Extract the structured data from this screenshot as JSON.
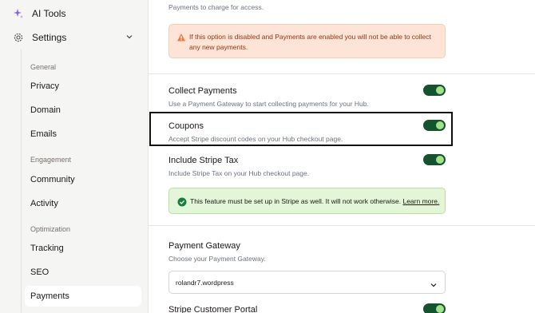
{
  "sidebar": {
    "ai_tools": "AI Tools",
    "settings": "Settings",
    "groups": {
      "general": "General",
      "engagement": "Engagement",
      "optimization": "Optimization"
    },
    "items": {
      "privacy": "Privacy",
      "domain": "Domain",
      "emails": "Emails",
      "community": "Community",
      "activity": "Activity",
      "tracking": "Tracking",
      "seo": "SEO",
      "payments": "Payments"
    }
  },
  "main": {
    "top_desc": "Payments to charge for access.",
    "warning": "If this option is disabled and Payments are enabled you will not be able to collect any new payments.",
    "collect_payments": {
      "title": "Collect Payments",
      "desc": "Use a Payment Gateway to start collecting payments for your Hub.",
      "enabled": true
    },
    "coupons": {
      "title": "Coupons",
      "desc": "Accept Stripe discount codes on your Hub checkout page.",
      "enabled": true
    },
    "stripe_tax": {
      "title": "Include Stripe Tax",
      "desc": "Include Stripe Tax on your Hub checkout page.",
      "enabled": true
    },
    "note": {
      "text": "This feature must be set up in Stripe as well. It will not work otherwise.",
      "link": "Learn more."
    },
    "gateway": {
      "title": "Payment Gateway",
      "desc": "Choose your Payment Gateway.",
      "selected": "rolandr7.wordpress"
    },
    "customer_portal": {
      "title": "Stripe Customer Portal",
      "enabled": true
    }
  },
  "colors": {
    "toggle_on": "#14532d",
    "toggle_knob": "#a3e08a",
    "warning_bg": "#fde4d6",
    "note_bg": "#e3f6d8"
  }
}
